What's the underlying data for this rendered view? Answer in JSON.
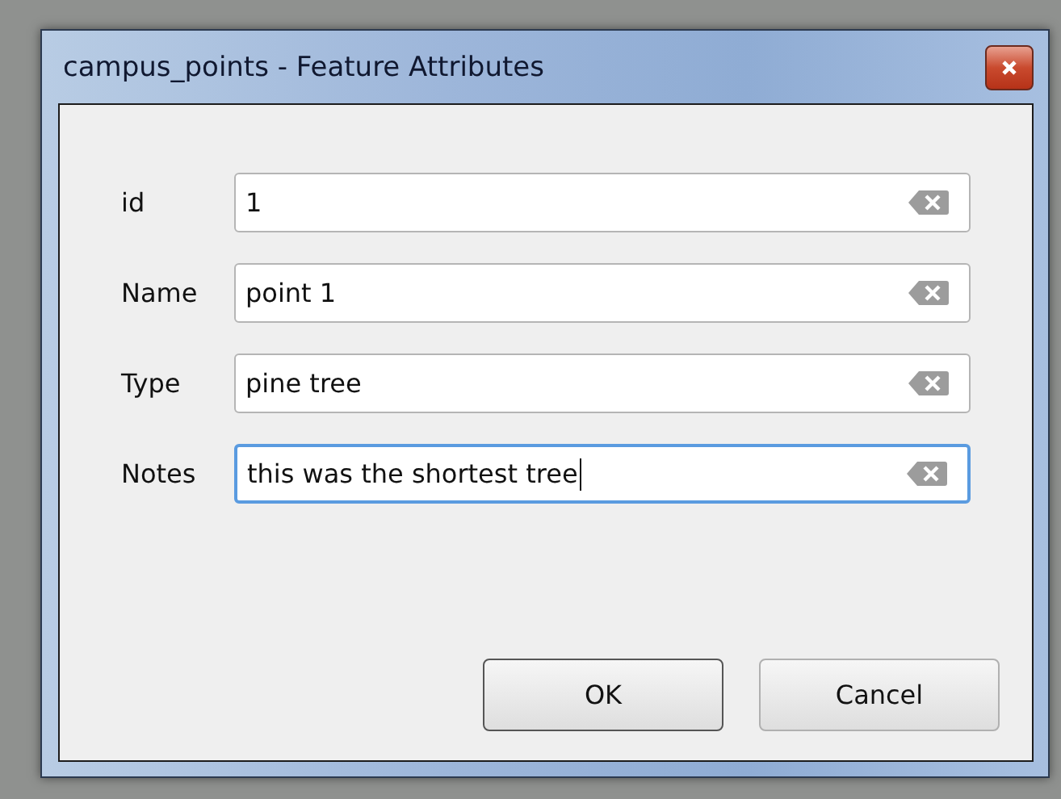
{
  "window": {
    "title": "campus_points - Feature Attributes"
  },
  "fields": [
    {
      "label": "id",
      "value": "1",
      "focused": false
    },
    {
      "label": "Name",
      "value": "point 1",
      "focused": false
    },
    {
      "label": "Type",
      "value": "pine tree",
      "focused": false
    },
    {
      "label": "Notes",
      "value": "this was the shortest tree",
      "focused": true
    }
  ],
  "buttons": [
    {
      "label": "OK",
      "default": true
    },
    {
      "label": "Cancel",
      "default": false
    }
  ]
}
